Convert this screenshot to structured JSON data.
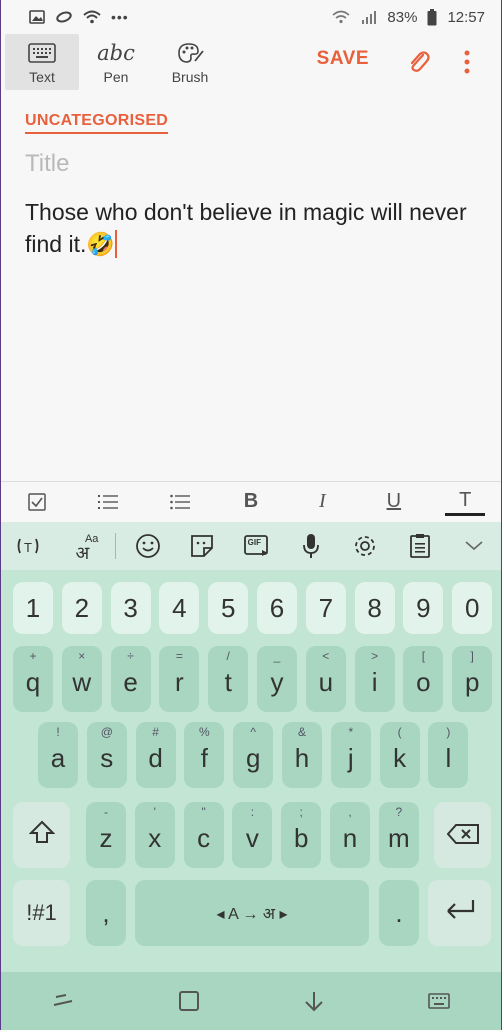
{
  "status_bar": {
    "battery": "83%",
    "time": "12:57",
    "more": "•••"
  },
  "toolbar": {
    "modes": [
      {
        "label": "Text",
        "icon": "keyboard-icon",
        "active": true
      },
      {
        "label": "Pen",
        "icon": "abc-handwriting-icon",
        "glyph": "abc"
      },
      {
        "label": "Brush",
        "icon": "palette-icon"
      }
    ],
    "save_label": "SAVE"
  },
  "note": {
    "category": "UNCATEGORISED",
    "title_placeholder": "Title",
    "body": "Those who don't believe in magic will never find it.",
    "emoji": "🤣"
  },
  "format_bar": {
    "items": [
      {
        "name": "checkbox-icon",
        "glyph": "☑"
      },
      {
        "name": "numbered-list-icon",
        "glyph": "≡"
      },
      {
        "name": "bulleted-list-icon",
        "glyph": "≡"
      },
      {
        "name": "bold-icon",
        "glyph": "B"
      },
      {
        "name": "italic-icon",
        "glyph": "I"
      },
      {
        "name": "underline-icon",
        "glyph": "U"
      },
      {
        "name": "text-color-icon",
        "glyph": "T"
      }
    ]
  },
  "keyboard_toolbar": {
    "lang_glyph_top": "Aa",
    "lang_glyph_bottom": "अ",
    "gif": "GIF"
  },
  "keyboard": {
    "numbers": [
      "1",
      "2",
      "3",
      "4",
      "5",
      "6",
      "7",
      "8",
      "9",
      "0"
    ],
    "row1": [
      {
        "k": "q",
        "s": "+"
      },
      {
        "k": "w",
        "s": "×"
      },
      {
        "k": "e",
        "s": "÷"
      },
      {
        "k": "r",
        "s": "="
      },
      {
        "k": "t",
        "s": "/"
      },
      {
        "k": "y",
        "s": "_"
      },
      {
        "k": "u",
        "s": "<"
      },
      {
        "k": "i",
        "s": ">"
      },
      {
        "k": "o",
        "s": "["
      },
      {
        "k": "p",
        "s": "]"
      }
    ],
    "row2": [
      {
        "k": "a",
        "s": "!"
      },
      {
        "k": "s",
        "s": "@"
      },
      {
        "k": "d",
        "s": "#"
      },
      {
        "k": "f",
        "s": "%"
      },
      {
        "k": "g",
        "s": "^"
      },
      {
        "k": "h",
        "s": "&"
      },
      {
        "k": "j",
        "s": "*"
      },
      {
        "k": "k",
        "s": "("
      },
      {
        "k": "l",
        "s": ")"
      }
    ],
    "row3": [
      {
        "k": "z",
        "s": "-"
      },
      {
        "k": "x",
        "s": "'"
      },
      {
        "k": "c",
        "s": "\""
      },
      {
        "k": "v",
        "s": ":"
      },
      {
        "k": "b",
        "s": ";"
      },
      {
        "k": "n",
        "s": ","
      },
      {
        "k": "m",
        "s": "?"
      }
    ],
    "symbols_label": "!#1",
    "comma": ",",
    "space_label": "◂ A → अ ▸",
    "period": "."
  },
  "colors": {
    "accent": "#e8603c",
    "keyboard_bg": "#c2e5d4",
    "key_bg": "#a8d6c0"
  }
}
